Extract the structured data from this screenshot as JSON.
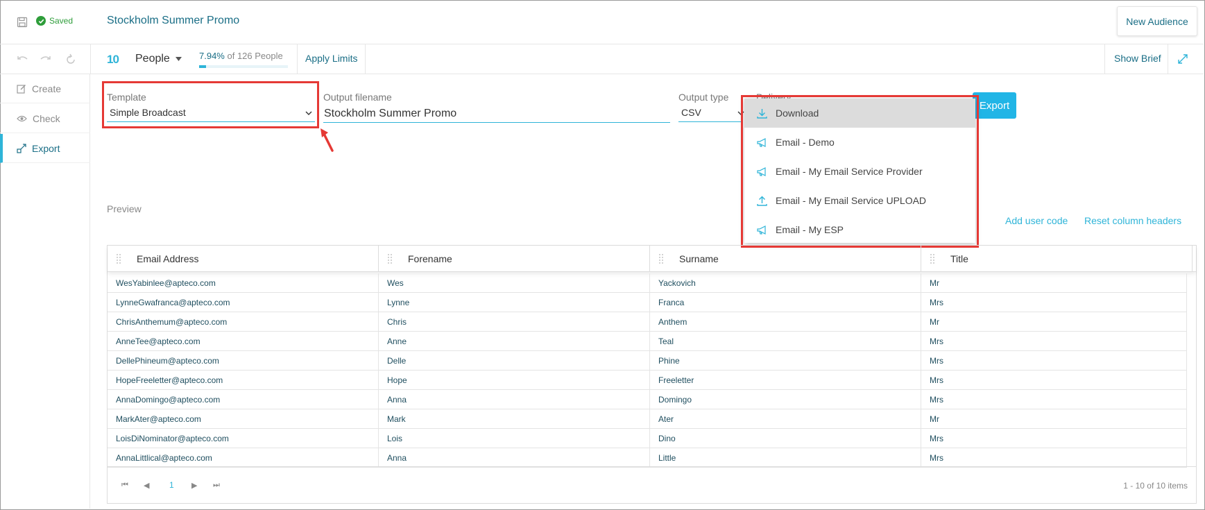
{
  "header": {
    "saved_label": "Saved",
    "title": "Stockholm Summer Promo",
    "new_audience_label": "New Audience"
  },
  "toolbar": {
    "count": "10",
    "people_label": "People",
    "pct_value": "7.94%",
    "pct_rest": " of 126 People",
    "pct_fraction": 0.0794,
    "apply_limits": "Apply Limits",
    "show_brief": "Show Brief"
  },
  "sidebar": {
    "items": [
      {
        "label": "Create",
        "icon": "edit-icon"
      },
      {
        "label": "Check",
        "icon": "eye-icon"
      },
      {
        "label": "Export",
        "icon": "export-icon"
      }
    ]
  },
  "form": {
    "template_label": "Template",
    "template_value": "Simple Broadcast",
    "filename_label": "Output filename",
    "filename_value": "Stockholm Summer Promo",
    "output_type_label": "Output type",
    "output_type_value": "CSV",
    "delivery_label": "Delivery",
    "export_label": "Export"
  },
  "delivery_menu": {
    "items": [
      {
        "label": "Download",
        "icon": "download-icon"
      },
      {
        "label": "Email - Demo",
        "icon": "megaphone-icon"
      },
      {
        "label": "Email - My Email Service Provider",
        "icon": "megaphone-icon"
      },
      {
        "label": "Email - My Email Service UPLOAD",
        "icon": "upload-icon"
      },
      {
        "label": "Email - My ESP",
        "icon": "megaphone-icon"
      }
    ]
  },
  "preview": {
    "label": "Preview",
    "add_user_code": "Add user code",
    "reset_headers": "Reset column headers",
    "columns": [
      "Email Address",
      "Forename",
      "Surname",
      "Title"
    ],
    "rows": [
      [
        "WesYabinlee@apteco.com",
        "Wes",
        "Yackovich",
        "Mr"
      ],
      [
        "LynneGwafranca@apteco.com",
        "Lynne",
        "Franca",
        "Mrs"
      ],
      [
        "ChrisAnthemum@apteco.com",
        "Chris",
        "Anthem",
        "Mr"
      ],
      [
        "AnneTee@apteco.com",
        "Anne",
        "Teal",
        "Mrs"
      ],
      [
        "DellePhineum@apteco.com",
        "Delle",
        "Phine",
        "Mrs"
      ],
      [
        "HopeFreeletter@apteco.com",
        "Hope",
        "Freeletter",
        "Mrs"
      ],
      [
        "AnnaDomingo@apteco.com",
        "Anna",
        "Domingo",
        "Mrs"
      ],
      [
        "MarkAter@apteco.com",
        "Mark",
        "Ater",
        "Mr"
      ],
      [
        "LoisDiNominator@apteco.com",
        "Lois",
        "Dino",
        "Mrs"
      ],
      [
        "AnnaLittlical@apteco.com",
        "Anna",
        "Little",
        "Mrs"
      ]
    ],
    "page_number": "1",
    "items_info": "1 - 10 of 10 items"
  },
  "colors": {
    "accent": "#2eb4d8",
    "title": "#1a6e86",
    "highlight": "#e53935",
    "saved": "#2e9d3a"
  }
}
